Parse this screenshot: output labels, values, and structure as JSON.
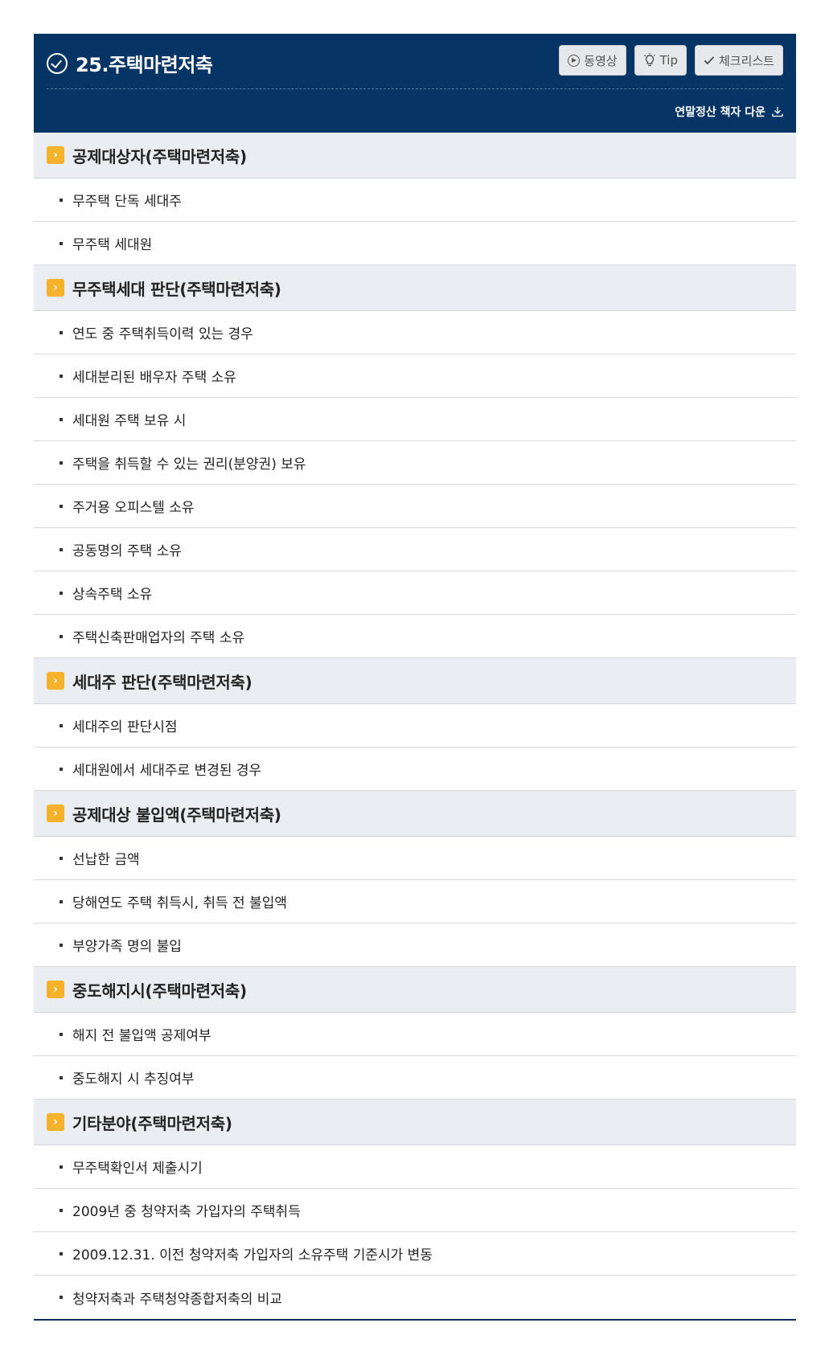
{
  "header": {
    "title": "25.주택마련저축",
    "buttons": {
      "video": "동영상",
      "tip": "Tip",
      "checklist": "체크리스트"
    },
    "download_label": "연말정산 책자 다운"
  },
  "sections": [
    {
      "title": "공제대상자(주택마련저축)",
      "items": [
        "무주택 단독 세대주",
        "무주택 세대원"
      ]
    },
    {
      "title": "무주택세대 판단(주택마련저축)",
      "items": [
        "연도 중 주택취득이력 있는 경우",
        "세대분리된 배우자 주택 소유",
        "세대원 주택 보유 시",
        "주택을 취득할 수 있는 권리(분양권) 보유",
        "주거용 오피스텔 소유",
        "공동명의 주택 소유",
        "상속주택 소유",
        "주택신축판매업자의 주택 소유"
      ]
    },
    {
      "title": "세대주 판단(주택마련저축)",
      "items": [
        "세대주의 판단시점",
        "세대원에서 세대주로 변경된 경우"
      ]
    },
    {
      "title": "공제대상 불입액(주택마련저축)",
      "items": [
        "선납한 금액",
        "당해연도 주택 취득시, 취득 전 불입액",
        "부양가족 명의 불입"
      ]
    },
    {
      "title": "중도해지시(주택마련저축)",
      "items": [
        "해지 전 불입액 공제여부",
        "중도해지 시 추징여부"
      ]
    },
    {
      "title": "기타분야(주택마련저축)",
      "items": [
        "무주택확인서 제출시기",
        "2009년 중 청약저축 가입자의 주택취득",
        "2009.12.31. 이전 청약저축 가입자의 소유주택 기준시가 변동",
        "청약저축과 주택청약종합저축의 비교"
      ]
    }
  ]
}
